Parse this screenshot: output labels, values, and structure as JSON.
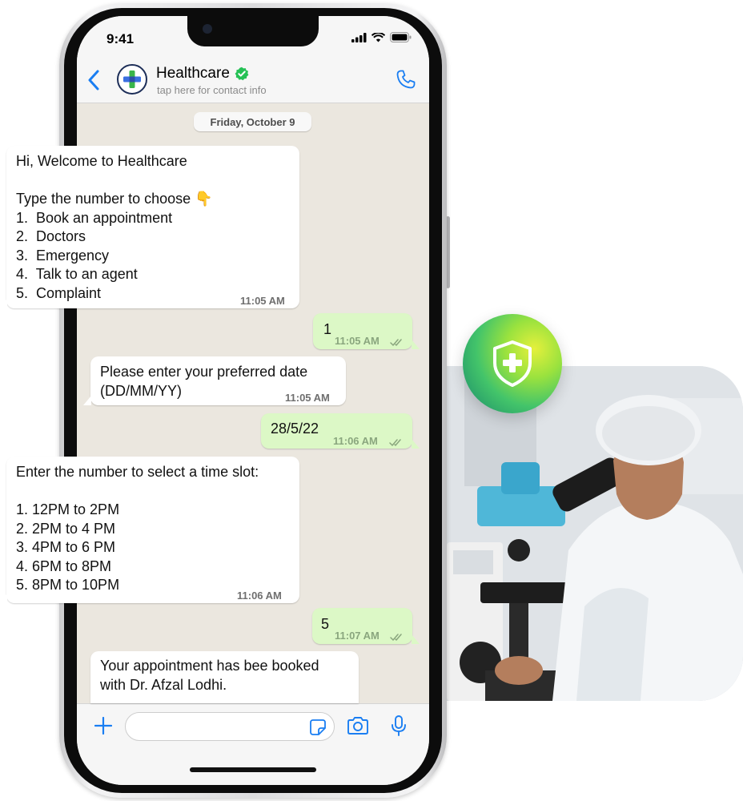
{
  "status_bar": {
    "time": "9:41"
  },
  "header": {
    "contact_name": "Healthcare",
    "contact_subtitle": "tap here for contact info"
  },
  "date_separator": "Friday, October 9",
  "messages": [
    {
      "direction": "incoming",
      "text": "Hi, Welcome to Healthcare\n\nType the number to choose 👇\n1.  Book an appointment\n2.  Doctors\n3.  Emergency\n4.  Talk to an agent\n5.  Complaint",
      "time": "11:05 AM"
    },
    {
      "direction": "outgoing",
      "text": "1",
      "time": "11:05 AM"
    },
    {
      "direction": "incoming",
      "text": "Please enter your preferred date\n(DD/MM/YY)",
      "time": "11:05 AM"
    },
    {
      "direction": "outgoing",
      "text": "28/5/22",
      "time": "11:06 AM"
    },
    {
      "direction": "incoming",
      "text": "Enter the number to select a time slot:\n\n1. 12PM to 2PM\n2. 2PM to 4 PM\n3. 4PM to 6 PM\n4. 6PM to 8PM\n5. 8PM to 10PM",
      "time": "11:06 AM"
    },
    {
      "direction": "outgoing",
      "text": "5",
      "time": "11:07 AM"
    },
    {
      "direction": "incoming",
      "text": "Your appointment has bee booked\nwith Dr. Afzal Lodhi."
    }
  ],
  "input": {
    "placeholder": "",
    "value": ""
  },
  "colors": {
    "accent_blue": "#1a7ef2",
    "verified_green": "#25c155",
    "outgoing_bubble": "#dcf8c6",
    "chat_background": "#ebe7df"
  }
}
